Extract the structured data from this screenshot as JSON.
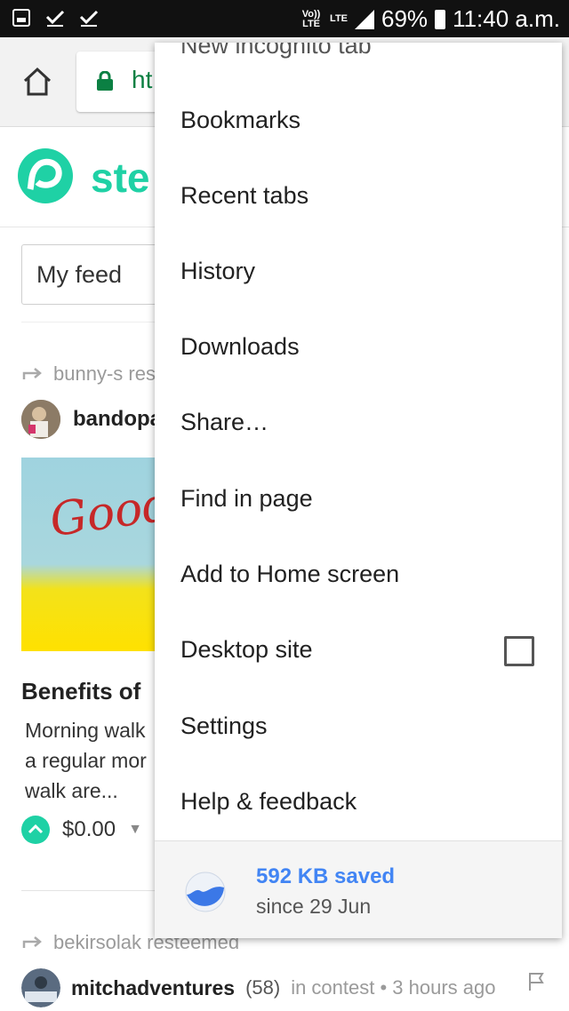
{
  "status_bar": {
    "volte_label": "Vo)) LTE",
    "lte_label": "LTE",
    "battery": "69%",
    "time": "11:40 a.m."
  },
  "browser": {
    "url_fragment": "ht"
  },
  "page": {
    "brand_fragment": "ste",
    "feed_selector": "My feed",
    "post1": {
      "resteemed_by": "bunny-s res",
      "author": "bandopa",
      "image_text": "Good",
      "title": "Benefits of",
      "excerpt_lines": [
        "Morning walk",
        "a regular mor",
        "walk are..."
      ],
      "payout": "$0.00"
    },
    "post2": {
      "resteemed_by": "bekirsolak resteemed",
      "author": "mitchadventures",
      "reputation": "(58)",
      "meta": "in contest • 3 hours ago"
    }
  },
  "menu": {
    "items": [
      {
        "label": "New incognito tab"
      },
      {
        "label": "Bookmarks"
      },
      {
        "label": "Recent tabs"
      },
      {
        "label": "History"
      },
      {
        "label": "Downloads"
      },
      {
        "label": "Share…"
      },
      {
        "label": "Find in page"
      },
      {
        "label": "Add to Home screen"
      },
      {
        "label": "Desktop site",
        "checked": false
      },
      {
        "label": "Settings"
      },
      {
        "label": "Help & feedback"
      }
    ],
    "data_saver": {
      "saved": "592 KB saved",
      "since": "since 29 Jun"
    }
  },
  "colors": {
    "accent": "#1fd1a5",
    "secure_green": "#0b8043",
    "link_blue": "#4285f4"
  }
}
